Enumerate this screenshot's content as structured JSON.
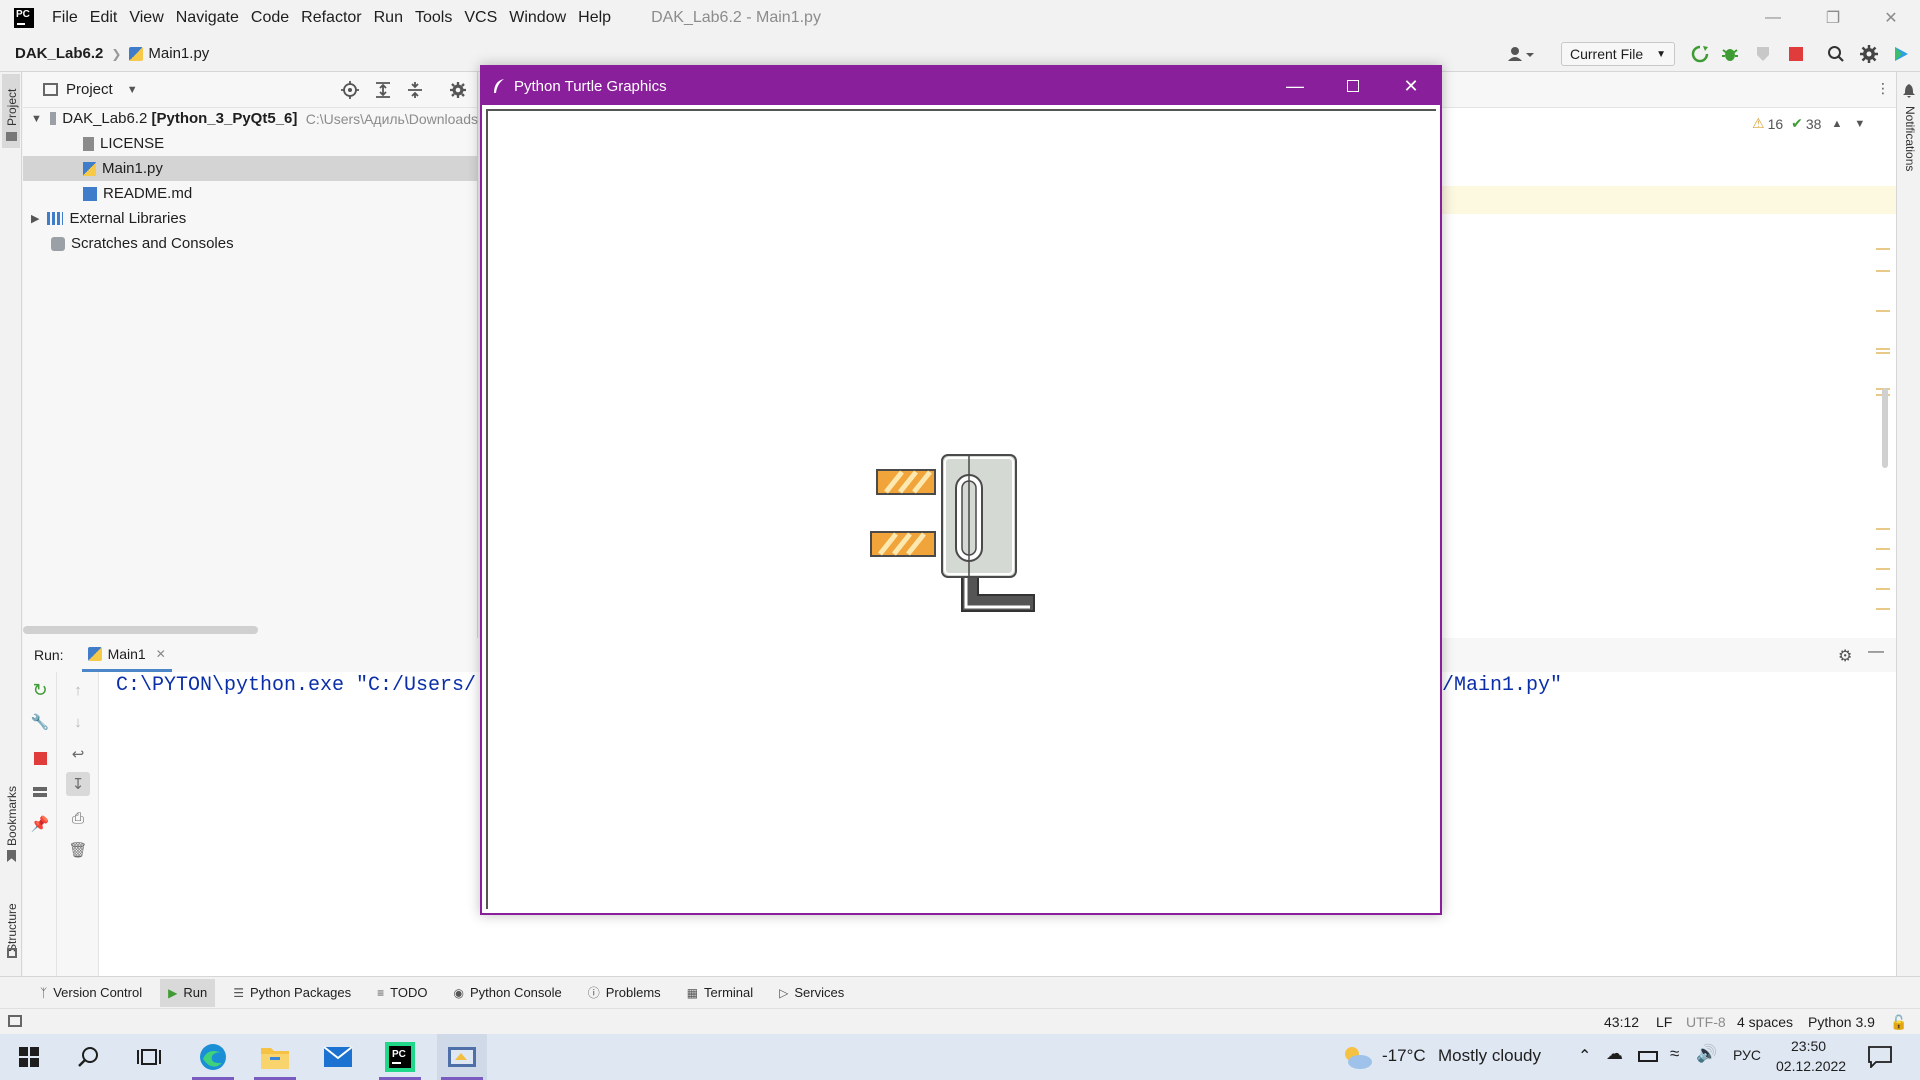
{
  "menubar": {
    "items": [
      "File",
      "Edit",
      "View",
      "Navigate",
      "Code",
      "Refactor",
      "Run",
      "Tools",
      "VCS",
      "Window",
      "Help"
    ],
    "window_title": "DAK_Lab6.2 - Main1.py"
  },
  "navbar": {
    "project": "DAK_Lab6.2",
    "file": "Main1.py",
    "run_config": "Current File"
  },
  "project_panel": {
    "title": "Project",
    "root_name": "DAK_Lab6.2",
    "root_module": "[Python_3_PyQt5_6]",
    "root_path": "C:\\Users\\Адиль\\Downloads",
    "items": [
      "LICENSE",
      "Main1.py",
      "README.md"
    ],
    "external": "External Libraries",
    "scratches": "Scratches and Consoles"
  },
  "editor": {
    "warnings": "16",
    "checks": "38"
  },
  "side_tabs": {
    "project": "Project",
    "bookmarks": "Bookmarks",
    "structure": "Structure",
    "notifications": "Notifications"
  },
  "run_panel": {
    "label": "Run:",
    "tab": "Main1",
    "console_left": "C:\\PYTON\\python.exe \"C:/Users/",
    "console_right": "/Main1.py\""
  },
  "tool_tabs": [
    "Version Control",
    "Run",
    "Python Packages",
    "TODO",
    "Python Console",
    "Problems",
    "Terminal",
    "Services"
  ],
  "status": {
    "position": "43:12",
    "line_sep": "LF",
    "encoding": "UTF-8",
    "indent": "4 spaces",
    "interpreter": "Python 3.9"
  },
  "turtle_window": {
    "title": "Python Turtle Graphics"
  },
  "taskbar": {
    "weather_temp": "-17°C",
    "weather_text": "Mostly cloudy",
    "lang": "РУС",
    "time": "23:50",
    "date": "02.12.2022"
  },
  "colors": {
    "turtle_titlebar": "#8a1f9c",
    "console_text": "#0b2fa8",
    "tape_orange": "#f0a43a"
  }
}
